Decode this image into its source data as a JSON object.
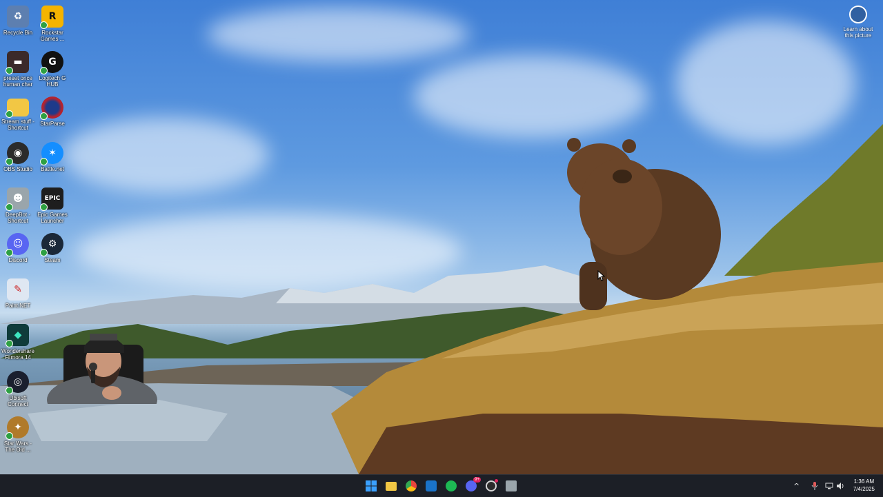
{
  "desktop": {
    "icons": [
      {
        "label": "Recycle Bin",
        "icon": "recycle-bin-icon",
        "color": "#5d7fb0"
      },
      {
        "label": "Rockstar Games ...",
        "icon": "rockstar-games-icon",
        "color": "#f5b400"
      },
      {
        "label": "preset once human char",
        "icon": "preset-icon",
        "color": "#3b2a2a"
      },
      {
        "label": "Logitech G HUB",
        "icon": "logitech-g-hub-icon",
        "color": "#111111"
      },
      {
        "label": "Stream stuff - Shortcut",
        "icon": "folder-icon",
        "color": "#f2c744"
      },
      {
        "label": "StarParse",
        "icon": "starparse-icon",
        "color": "#b3232f"
      },
      {
        "label": "OBS Studio",
        "icon": "obs-studio-icon",
        "color": "#2b2b2b"
      },
      {
        "label": "Battle.net",
        "icon": "battlenet-icon",
        "color": "#148eff"
      },
      {
        "label": "DeepBot - Shortcut",
        "icon": "deepbot-icon",
        "color": "#9aa5ab"
      },
      {
        "label": "Epic Games Launcher",
        "icon": "epic-games-icon",
        "color": "#1e1e1e"
      },
      {
        "label": "Discord",
        "icon": "discord-icon",
        "color": "#5865f2"
      },
      {
        "label": "Steam",
        "icon": "steam-icon",
        "color": "#1b2838"
      },
      {
        "label": "Paint.NET",
        "icon": "paintnet-icon",
        "color": "#dfe7f2"
      },
      {
        "label": "Wondershare Filmora 14",
        "icon": "filmora-icon",
        "color": "#0f3b3a"
      },
      {
        "label": "Ubisoft Connect",
        "icon": "ubisoft-connect-icon",
        "color": "#1a1f2e"
      },
      {
        "label": "Star Wars - The Old ...",
        "icon": "swtor-icon",
        "color": "#b07a2a"
      }
    ],
    "learn_label": "Learn about this picture",
    "taskbar": {
      "apps": [
        {
          "name": "start-button",
          "icon": "windows-logo-icon",
          "color": "#3aa0ff"
        },
        {
          "name": "taskbar-file-explorer",
          "icon": "folder-icon",
          "color": "#f2c744"
        },
        {
          "name": "taskbar-chrome",
          "icon": "chrome-icon",
          "color": "#e8453c"
        },
        {
          "name": "taskbar-outlook",
          "icon": "outlook-icon",
          "color": "#1a73c9"
        },
        {
          "name": "taskbar-spotify",
          "icon": "spotify-icon",
          "color": "#1db954"
        },
        {
          "name": "taskbar-discord",
          "icon": "discord-icon",
          "color": "#5865f2"
        },
        {
          "name": "taskbar-obs",
          "icon": "obs-studio-icon",
          "color": "#d6d6d6"
        },
        {
          "name": "taskbar-game",
          "icon": "game-app-icon",
          "color": "#9aa5ab"
        }
      ],
      "discord_badge": "9+",
      "tray": {
        "chevron": "^",
        "time": "1:36 AM",
        "date": "7/4/2025"
      }
    }
  }
}
